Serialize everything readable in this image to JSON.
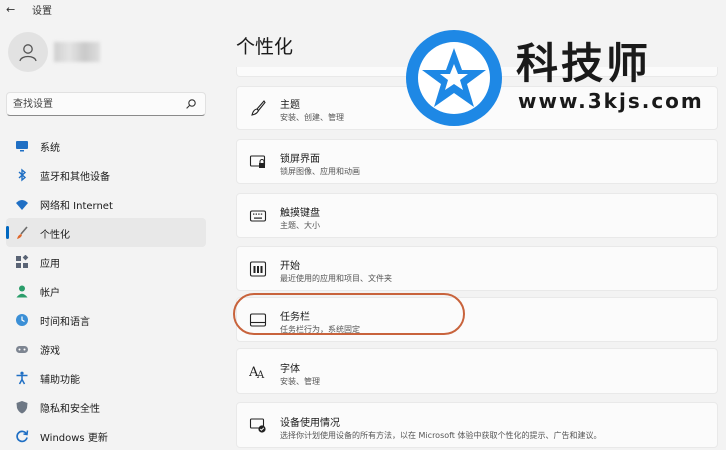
{
  "app": {
    "title": "设置"
  },
  "sidebar": {
    "search": {
      "placeholder": "查找设置"
    },
    "items": [
      {
        "label": "系统",
        "icon": "monitor-icon"
      },
      {
        "label": "蓝牙和其他设备",
        "icon": "bluetooth-icon"
      },
      {
        "label": "网络和 Internet",
        "icon": "wifi-icon"
      },
      {
        "label": "个性化",
        "icon": "brush-icon",
        "active": true
      },
      {
        "label": "应用",
        "icon": "apps-icon"
      },
      {
        "label": "帐户",
        "icon": "person-icon"
      },
      {
        "label": "时间和语言",
        "icon": "globe-clock-icon"
      },
      {
        "label": "游戏",
        "icon": "gamepad-icon"
      },
      {
        "label": "辅助功能",
        "icon": "accessibility-icon"
      },
      {
        "label": "隐私和安全性",
        "icon": "shield-icon"
      },
      {
        "label": "Windows 更新",
        "icon": "update-icon"
      }
    ]
  },
  "main": {
    "title": "个性化",
    "cards": [
      {
        "title": "主题",
        "subtitle": "安装、创建、管理",
        "icon": "theme-brush-icon"
      },
      {
        "title": "锁屏界面",
        "subtitle": "锁屏图像、应用和动画",
        "icon": "lock-screen-icon"
      },
      {
        "title": "触摸键盘",
        "subtitle": "主题、大小",
        "icon": "keyboard-icon"
      },
      {
        "title": "开始",
        "subtitle": "最近使用的应用和项目、文件夹",
        "icon": "start-icon"
      },
      {
        "title": "任务栏",
        "subtitle": "任务栏行为，系统固定",
        "icon": "taskbar-icon"
      },
      {
        "title": "字体",
        "subtitle": "安装、管理",
        "icon": "fonts-icon"
      },
      {
        "title": "设备使用情况",
        "subtitle": "选择你计划使用设备的所有方法，以在 Microsoft 体验中获取个性化的提示、广告和建议。",
        "icon": "device-usage-icon"
      }
    ]
  },
  "watermark": {
    "brand": "科技师",
    "url": "www.3kjs.com"
  },
  "colors": {
    "accent": "#0067c0",
    "highlight": "#c8633c",
    "watermark_blue": "#1e88e5"
  }
}
